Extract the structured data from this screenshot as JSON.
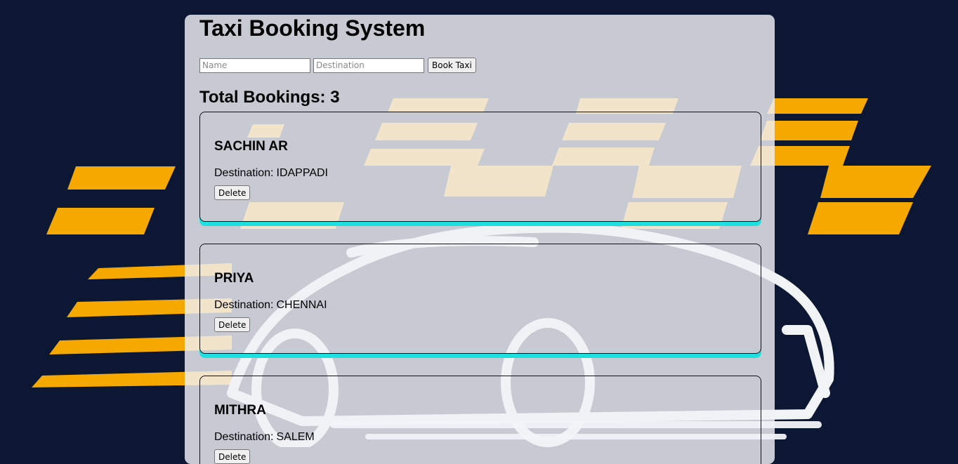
{
  "app": {
    "title": "Taxi Booking System"
  },
  "form": {
    "name_placeholder": "Name",
    "name_value": "",
    "destination_placeholder": "Destination",
    "destination_value": "",
    "book_label": "Book Taxi"
  },
  "summary": {
    "total_label": "Total Bookings:",
    "total_count": "3"
  },
  "bookings": [
    {
      "name": "SACHIN AR",
      "destination_label": "Destination:",
      "destination": "IDAPPADI",
      "delete_label": "Delete"
    },
    {
      "name": "PRIYA",
      "destination_label": "Destination:",
      "destination": "CHENNAI",
      "delete_label": "Delete"
    },
    {
      "name": "MITHRA",
      "destination_label": "Destination:",
      "destination": "SALEM",
      "delete_label": "Delete"
    }
  ],
  "colors": {
    "page_background": "#0b1733",
    "stripe_color": "#f5a800",
    "card_shadow": "#1ee0e0"
  }
}
